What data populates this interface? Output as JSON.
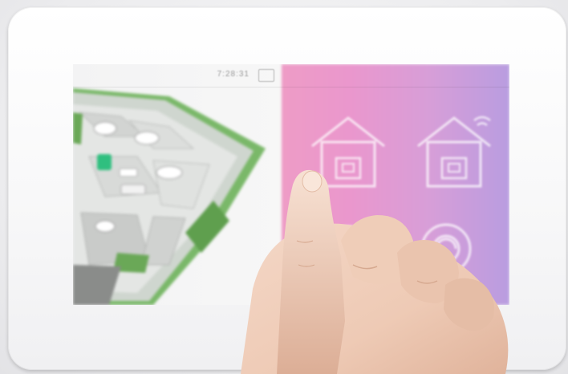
{
  "status_bar": {
    "time": "7:28:31"
  },
  "home_tiles": [
    {
      "icon": "home-icon"
    },
    {
      "icon": "home-wifi-icon"
    },
    {
      "icon": "power-icon"
    },
    {
      "icon": "settings-icon"
    }
  ],
  "colors": {
    "screen_gradient_start": "#ee9cc6",
    "screen_gradient_end": "#b99de0",
    "device_bezel": "#ffffff",
    "floorplan_grass": "#6cae5a",
    "floorplan_highlight": "#2fbf7f"
  }
}
